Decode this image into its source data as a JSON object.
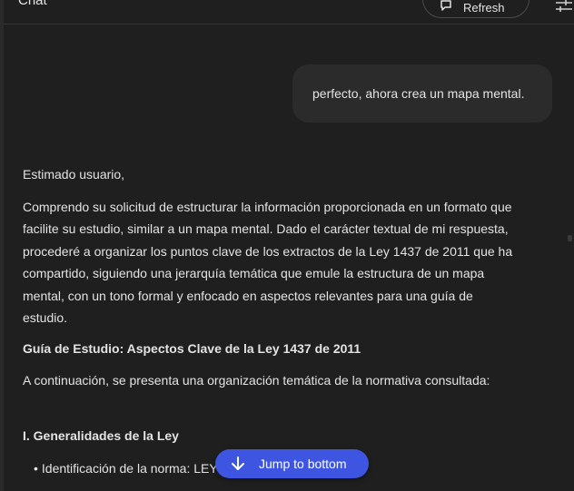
{
  "header": {
    "title": "Chat",
    "refresh_label": "Refresh"
  },
  "user_message": "perfecto, ahora crea un mapa mental.",
  "response": {
    "greeting": "Estimado usuario,",
    "intro": "Comprendo su solicitud de estructurar la información proporcionada en un formato que facilite su estudio, similar a un mapa mental. Dado el carácter textual de mi respuesta, procederé a organizar los puntos clave de los extractos de la Ley 1437 de 2011 que ha compartido, siguiendo una jerarquía temática que emule la estructura de un mapa mental, con un tono formal y enfocado en aspectos relevantes para una guía de estudio.",
    "heading": "Guía de Estudio: Aspectos Clave de la Ley 1437 de 2011",
    "lead": "A continuación, se presenta una organización temática de la normativa consultada:",
    "section_heading": "I. Generalidades de la Ley",
    "bullet_text": "Identificación de la norma: LEY"
  },
  "jump_button": {
    "label": "Jump to bottom"
  },
  "colors": {
    "background": "#1f1f1f",
    "bubble": "#2b2b2b",
    "accent": "#3d55e0"
  }
}
